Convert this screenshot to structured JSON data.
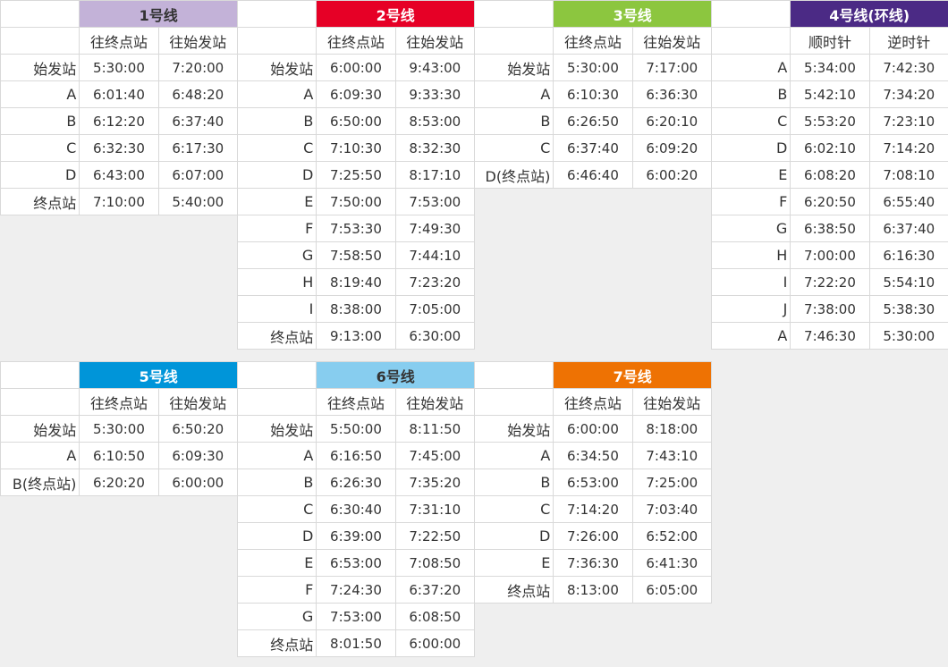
{
  "lines": [
    {
      "title": "1号线",
      "color": "#c3b2d8",
      "text_color": "#333333",
      "headers": [
        "往终点站",
        "往始发站"
      ],
      "rows": [
        [
          "始发站",
          "5:30:00",
          "7:20:00"
        ],
        [
          "A",
          "6:01:40",
          "6:48:20"
        ],
        [
          "B",
          "6:12:20",
          "6:37:40"
        ],
        [
          "C",
          "6:32:30",
          "6:17:30"
        ],
        [
          "D",
          "6:43:00",
          "6:07:00"
        ],
        [
          "终点站",
          "7:10:00",
          "5:40:00"
        ]
      ]
    },
    {
      "title": "2号线",
      "color": "#e60026",
      "text_color": "#ffffff",
      "headers": [
        "往终点站",
        "往始发站"
      ],
      "rows": [
        [
          "始发站",
          "6:00:00",
          "9:43:00"
        ],
        [
          "A",
          "6:09:30",
          "9:33:30"
        ],
        [
          "B",
          "6:50:00",
          "8:53:00"
        ],
        [
          "C",
          "7:10:30",
          "8:32:30"
        ],
        [
          "D",
          "7:25:50",
          "8:17:10"
        ],
        [
          "E",
          "7:50:00",
          "7:53:00"
        ],
        [
          "F",
          "7:53:30",
          "7:49:30"
        ],
        [
          "G",
          "7:58:50",
          "7:44:10"
        ],
        [
          "H",
          "8:19:40",
          "7:23:20"
        ],
        [
          "I",
          "8:38:00",
          "7:05:00"
        ],
        [
          "终点站",
          "9:13:00",
          "6:30:00"
        ]
      ]
    },
    {
      "title": "3号线",
      "color": "#8cc63f",
      "text_color": "#ffffff",
      "headers": [
        "往终点站",
        "往始发站"
      ],
      "rows": [
        [
          "始发站",
          "5:30:00",
          "7:17:00"
        ],
        [
          "A",
          "6:10:30",
          "6:36:30"
        ],
        [
          "B",
          "6:26:50",
          "6:20:10"
        ],
        [
          "C",
          "6:37:40",
          "6:09:20"
        ],
        [
          "D(终点站)",
          "6:46:40",
          "6:00:20"
        ]
      ]
    },
    {
      "title": "4号线(环线)",
      "color": "#4b2a85",
      "text_color": "#ffffff",
      "headers": [
        "顺时针",
        "逆时针"
      ],
      "rows": [
        [
          "A",
          "5:34:00",
          "7:42:30"
        ],
        [
          "B",
          "5:42:10",
          "7:34:20"
        ],
        [
          "C",
          "5:53:20",
          "7:23:10"
        ],
        [
          "D",
          "6:02:10",
          "7:14:20"
        ],
        [
          "E",
          "6:08:20",
          "7:08:10"
        ],
        [
          "F",
          "6:20:50",
          "6:55:40"
        ],
        [
          "G",
          "6:38:50",
          "6:37:40"
        ],
        [
          "H",
          "7:00:00",
          "6:16:30"
        ],
        [
          "I",
          "7:22:20",
          "5:54:10"
        ],
        [
          "J",
          "7:38:00",
          "5:38:30"
        ],
        [
          "A",
          "7:46:30",
          "5:30:00"
        ]
      ]
    },
    {
      "title": "5号线",
      "color": "#0095d9",
      "text_color": "#ffffff",
      "headers": [
        "往终点站",
        "往始发站"
      ],
      "rows": [
        [
          "始发站",
          "5:30:00",
          "6:50:20"
        ],
        [
          "A",
          "6:10:50",
          "6:09:30"
        ],
        [
          "B(终点站)",
          "6:20:20",
          "6:00:00"
        ]
      ]
    },
    {
      "title": "6号线",
      "color": "#87cdef",
      "text_color": "#333333",
      "headers": [
        "往终点站",
        "往始发站"
      ],
      "rows": [
        [
          "始发站",
          "5:50:00",
          "8:11:50"
        ],
        [
          "A",
          "6:16:50",
          "7:45:00"
        ],
        [
          "B",
          "6:26:30",
          "7:35:20"
        ],
        [
          "C",
          "6:30:40",
          "7:31:10"
        ],
        [
          "D",
          "6:39:00",
          "7:22:50"
        ],
        [
          "E",
          "6:53:00",
          "7:08:50"
        ],
        [
          "F",
          "7:24:30",
          "6:37:20"
        ],
        [
          "G",
          "7:53:00",
          "6:08:50"
        ],
        [
          "终点站",
          "8:01:50",
          "6:00:00"
        ]
      ]
    },
    {
      "title": "7号线",
      "color": "#ee7203",
      "text_color": "#ffffff",
      "headers": [
        "往终点站",
        "往始发站"
      ],
      "rows": [
        [
          "始发站",
          "6:00:00",
          "8:18:00"
        ],
        [
          "A",
          "6:34:50",
          "7:43:10"
        ],
        [
          "B",
          "6:53:00",
          "7:25:00"
        ],
        [
          "C",
          "7:14:20",
          "7:03:40"
        ],
        [
          "D",
          "7:26:00",
          "6:52:00"
        ],
        [
          "E",
          "7:36:30",
          "6:41:30"
        ],
        [
          "终点站",
          "8:13:00",
          "6:05:00"
        ]
      ]
    }
  ]
}
